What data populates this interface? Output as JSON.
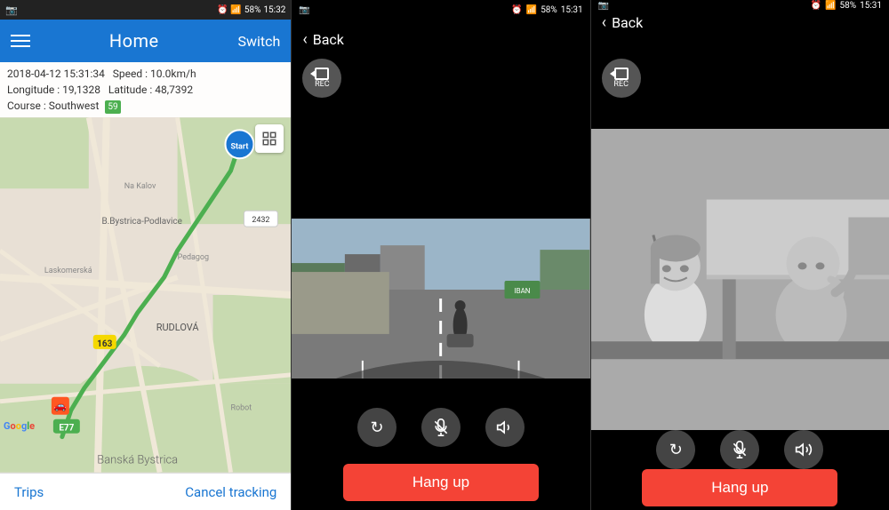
{
  "panel_map": {
    "status_bar": {
      "left_icon": "camera-icon",
      "time": "15:32",
      "battery": "58%",
      "signal": "●●●"
    },
    "header": {
      "title": "Home",
      "switch_label": "Switch",
      "menu_icon": "hamburger-icon"
    },
    "info": {
      "date_time": "2018-04-12  15:31:34",
      "speed_label": "Speed :",
      "speed_value": "10.0km/h",
      "longitude_label": "Longitude :",
      "longitude_value": "19,1328",
      "latitude_label": "Latitude :",
      "latitude_value": "48,7392",
      "course_label": "Course :",
      "course_value": "Southwest",
      "badge": "59"
    },
    "bottom": {
      "trips_label": "Trips",
      "cancel_label": "Cancel tracking"
    },
    "map": {
      "start_marker": "Start",
      "road_label_163": "163",
      "road_label_e77": "E77",
      "city_label": "Banská Bystrica",
      "district_label": "B.Bystrica-Podlavice",
      "rudlova_label": "RUDLOVÁ",
      "google_label": "Google"
    }
  },
  "panel_call_front": {
    "status_bar": {
      "time": "15:31",
      "battery": "58%"
    },
    "header": {
      "back_label": "Back"
    },
    "rec_label": "REC",
    "controls": {
      "rotate_icon": "↻",
      "mute_icon": "🎙",
      "speaker_icon": "🔊"
    },
    "hang_up_label": "Hang up"
  },
  "panel_call_interior": {
    "status_bar": {
      "time": "15:31",
      "battery": "58%"
    },
    "header": {
      "back_label": "Back"
    },
    "rec_label": "REC",
    "controls": {
      "rotate_icon": "↻",
      "mute_icon": "🎙",
      "speaker_icon": "🔊"
    },
    "hang_up_label": "Hang up"
  }
}
